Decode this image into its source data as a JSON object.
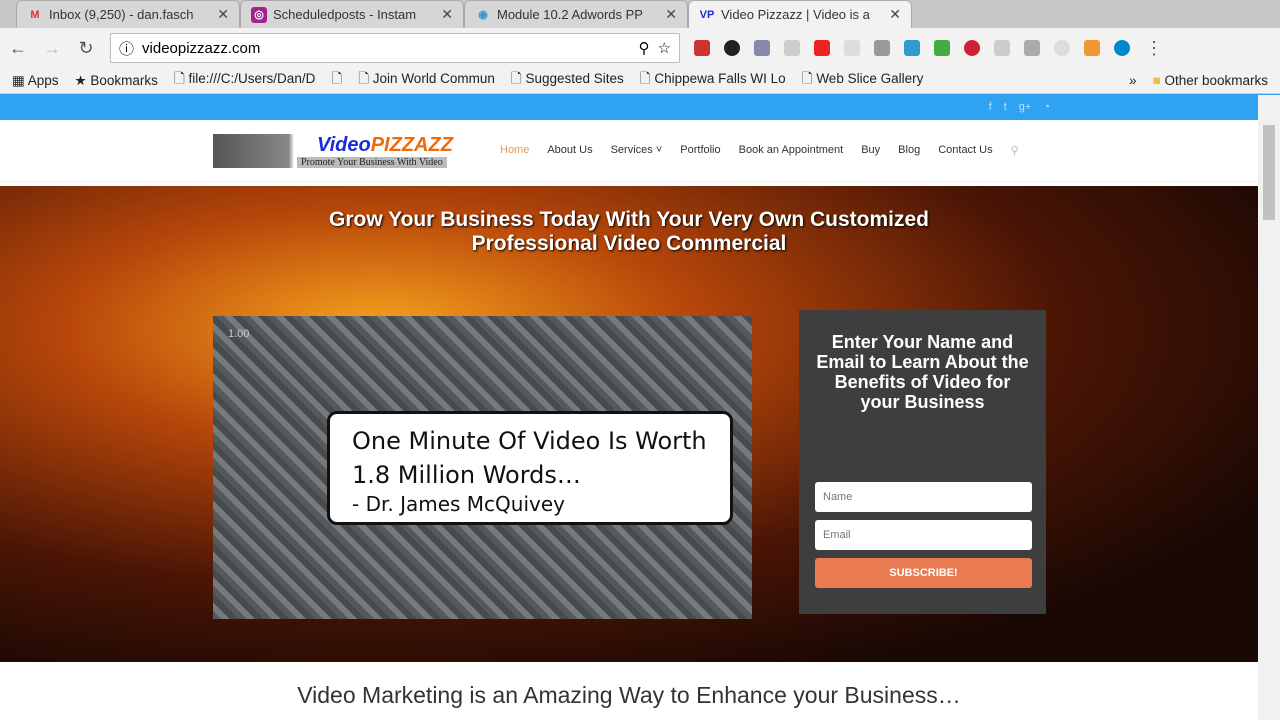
{
  "tabs": [
    {
      "title": "Inbox (9,250) - dan.fasch",
      "icon": "gmail-icon"
    },
    {
      "title": "Scheduledposts - Instam",
      "icon": "instagram-icon"
    },
    {
      "title": "Module 10.2 Adwords PP",
      "icon": "globe-icon"
    },
    {
      "title": "Video Pizzazz | Video is a",
      "icon": "vp-icon"
    }
  ],
  "url": "videopizzazz.com",
  "bookmarks": [
    "Apps",
    "Bookmarks",
    "file:///C:/Users/Dan/D",
    "Join World Commun",
    "Suggested Sites",
    "Chippewa Falls WI Lo",
    "Web Slice Gallery",
    "Other bookmarks"
  ],
  "logo": {
    "text1": "Video",
    "text2": "PIZZAZZ",
    "tagline": "Promote Your Business With Video"
  },
  "menu": [
    "Home",
    "About Us",
    "Services",
    "Portfolio",
    "Book an Appointment",
    "Buy",
    "Blog",
    "Contact Us"
  ],
  "hero": {
    "title1": "Grow Your Business Today With Your Very Own Customized",
    "title2": "Professional Video Commercial"
  },
  "video": {
    "speed": "1.00",
    "quote": "One Minute Of Video Is Worth 1.8 Million Words…",
    "author": "- Dr. James McQuivey"
  },
  "form": {
    "heading": "Enter Your Name and Email to Learn About the Benefits of Video for your Business",
    "name_placeholder": "Name",
    "email_placeholder": "Email",
    "submit": "SUBSCRIBE!"
  },
  "subheading": "Video Marketing is an Amazing Way to Enhance your Business…"
}
